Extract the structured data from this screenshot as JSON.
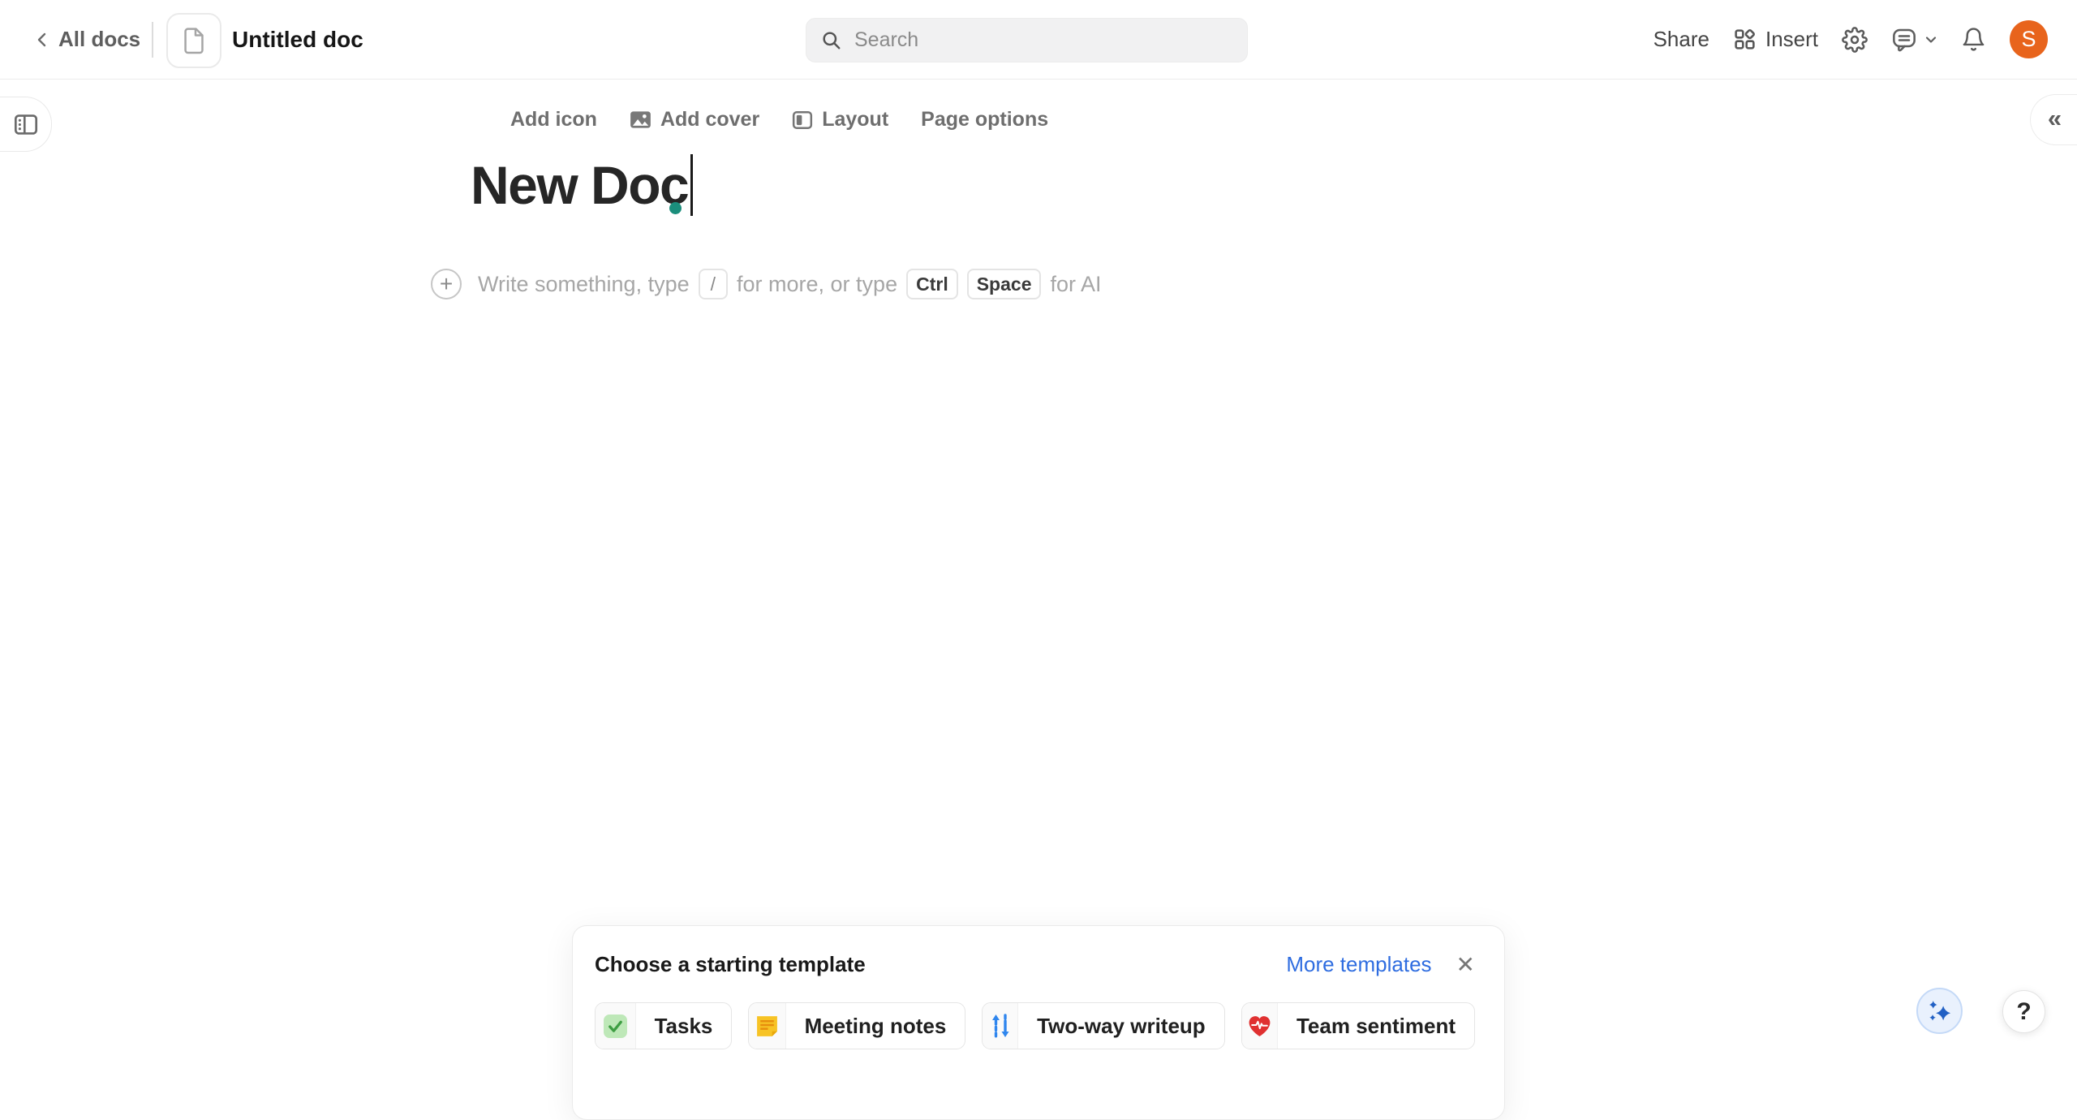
{
  "topbar": {
    "back": {
      "label": "All docs"
    },
    "doc_title": "Untitled doc",
    "search": {
      "placeholder": "Search"
    },
    "share_label": "Share",
    "insert_label": "Insert",
    "avatar": {
      "initial": "S",
      "color": "#E8641C"
    }
  },
  "edge_controls": {
    "collapse_right_glyph": "«"
  },
  "page_toolbar": {
    "add_icon_label": "Add icon",
    "add_cover_label": "Add cover",
    "layout_label": "Layout",
    "page_options_label": "Page options"
  },
  "editor": {
    "title": "New Doc",
    "add_block_glyph": "+",
    "placeholder": {
      "pre": "Write something, type",
      "slash_key": "/",
      "mid": "for more, or type",
      "ctrl_key": "Ctrl",
      "space_key": "Space",
      "post": "for AI"
    }
  },
  "template_panel": {
    "heading": "Choose a starting template",
    "more_templates_label": "More templates",
    "close_glyph": "✕",
    "templates": [
      {
        "label": "Tasks",
        "icon": "checkbox-check-icon"
      },
      {
        "label": "Meeting notes",
        "icon": "sticky-note-icon"
      },
      {
        "label": "Two-way writeup",
        "icon": "two-way-arrows-icon"
      },
      {
        "label": "Team sentiment",
        "icon": "heart-pulse-icon"
      }
    ]
  },
  "floating_buttons": {
    "help_glyph": "?"
  },
  "colors": {
    "accent_teal": "#1B8E7C",
    "avatar_orange": "#E8641C",
    "link_blue": "#2F6DE0",
    "sparkle_blue": "#2160C4",
    "tasks_green": "#3E9E43",
    "note_yellow": "#F7C325",
    "arrows_blue": "#2F86EE",
    "heart_red": "#E03131"
  }
}
